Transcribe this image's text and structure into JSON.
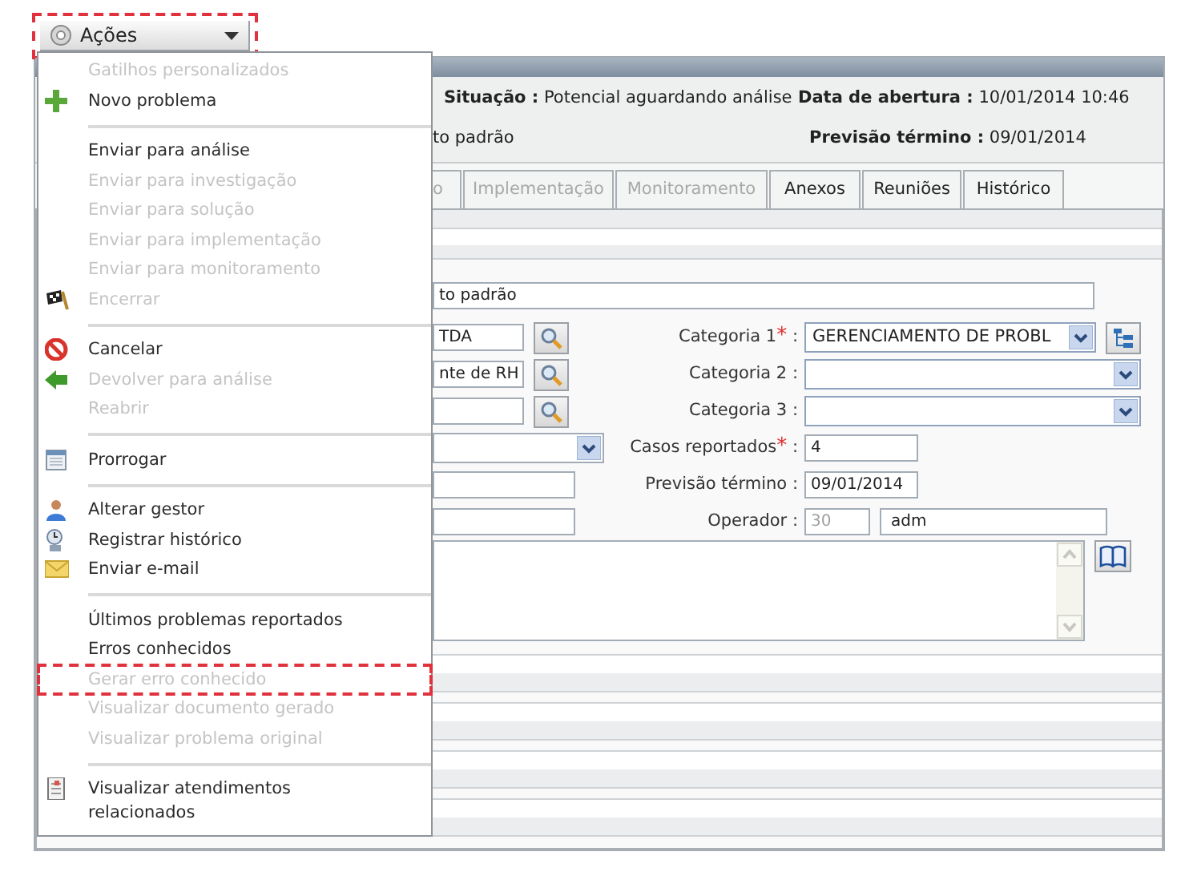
{
  "actions_button": {
    "label": "Ações",
    "highlighted": true
  },
  "menu": [
    {
      "kind": "item",
      "label": "Gatilhos personalizados",
      "disabled": true,
      "highlighted": false
    },
    {
      "kind": "item",
      "label": "Novo problema",
      "disabled": false,
      "highlighted": false
    },
    {
      "kind": "separator"
    },
    {
      "kind": "item",
      "label": "Enviar para análise",
      "disabled": false,
      "highlighted": false
    },
    {
      "kind": "item",
      "label": "Enviar para investigação",
      "disabled": true,
      "highlighted": false
    },
    {
      "kind": "item",
      "label": "Enviar para solução",
      "disabled": true,
      "highlighted": false
    },
    {
      "kind": "item",
      "label": "Enviar para implementação",
      "disabled": true,
      "highlighted": false
    },
    {
      "kind": "item",
      "label": "Enviar para monitoramento",
      "disabled": true,
      "highlighted": false
    },
    {
      "kind": "item",
      "label": "Encerrar",
      "disabled": true,
      "highlighted": false
    },
    {
      "kind": "separator"
    },
    {
      "kind": "item",
      "label": "Cancelar",
      "disabled": false,
      "highlighted": false
    },
    {
      "kind": "item",
      "label": "Devolver para análise",
      "disabled": true,
      "highlighted": false
    },
    {
      "kind": "item",
      "label": "Reabrir",
      "disabled": true,
      "highlighted": false
    },
    {
      "kind": "separator"
    },
    {
      "kind": "item",
      "label": "Prorrogar",
      "disabled": false,
      "highlighted": false
    },
    {
      "kind": "separator"
    },
    {
      "kind": "item",
      "label": "Alterar gestor",
      "disabled": false,
      "highlighted": false
    },
    {
      "kind": "item",
      "label": "Registrar histórico",
      "disabled": false,
      "highlighted": false
    },
    {
      "kind": "item",
      "label": "Enviar e-mail",
      "disabled": false,
      "highlighted": false
    },
    {
      "kind": "separator"
    },
    {
      "kind": "item",
      "label": "Últimos problemas reportados",
      "disabled": false,
      "highlighted": false
    },
    {
      "kind": "item",
      "label": "Erros conhecidos",
      "disabled": false,
      "highlighted": false
    },
    {
      "kind": "item",
      "label": "Gerar erro conhecido",
      "disabled": true,
      "highlighted": true
    },
    {
      "kind": "item",
      "label": "Visualizar documento gerado",
      "disabled": true,
      "highlighted": false
    },
    {
      "kind": "item",
      "label": "Visualizar problema original",
      "disabled": true,
      "highlighted": false
    },
    {
      "kind": "separator"
    },
    {
      "kind": "item",
      "label": "Visualizar atendimentos relacionados",
      "disabled": false,
      "highlighted": false
    }
  ],
  "info": {
    "situacao": "**Situação :** Potencial aguardando análise",
    "data_abertura": "**Data de abertura :** 10/01/2014 10:46",
    "line_2": "to padrão",
    "previsao": "**Previsão término :** 09/01/2014"
  },
  "tabs": [
    {
      "label": "o",
      "disabled": true
    },
    {
      "label": "Implementação",
      "disabled": true
    },
    {
      "label": "Monitoramento",
      "disabled": true
    },
    {
      "label": "Anexos",
      "disabled": false
    },
    {
      "label": "Reuniões",
      "disabled": false
    },
    {
      "label": "Histórico",
      "disabled": false
    }
  ],
  "main_field": {
    "value": "to padrão"
  },
  "rows": [
    {
      "left": {
        "kind": "lookup",
        "value": "TDA"
      },
      "label": "Categoria 1",
      "mark": "*",
      "after": ":",
      "right": {
        "kind": "select_tree",
        "value": "GERENCIAMENTO DE PROBL"
      }
    },
    {
      "left": {
        "kind": "lookup",
        "value": "nte de RH"
      },
      "label": "Categoria 2",
      "after": ":",
      "right": {
        "kind": "select"
      }
    },
    {
      "left": {
        "kind": "lookup"
      },
      "label": "Categoria 3",
      "after": ":",
      "right": {
        "kind": "select"
      }
    },
    {
      "left": {
        "kind": "select"
      },
      "label": "Casos reportados",
      "mark": "*",
      "after": ":",
      "right": {
        "kind": "text",
        "value": "4"
      }
    },
    {
      "left": {
        "kind": "text"
      },
      "label": "Previsão término",
      "after": ":",
      "right": {
        "kind": "text",
        "value": "09/01/2014"
      }
    },
    {
      "left": {
        "kind": "text"
      },
      "label": "Operador",
      "after": ":",
      "right": {
        "kind": "pair",
        "code": "30",
        "name": "adm"
      }
    }
  ]
}
